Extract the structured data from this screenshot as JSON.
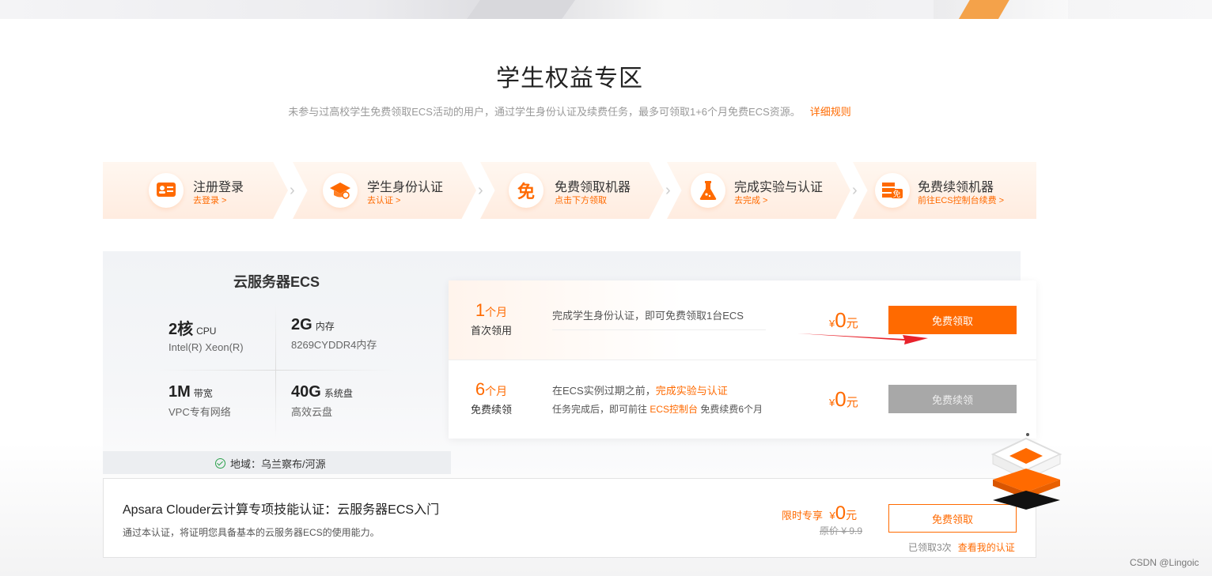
{
  "page": {
    "title": "学生权益专区",
    "subtitle": "未参与过高校学生免费领取ECS活动的用户，通过学生身份认证及续费任务，最多可领取1+6个月免费ECS资源。",
    "rule_link": "详细规则"
  },
  "steps": [
    {
      "label": "注册登录",
      "sub": "去登录 >",
      "icon": "id-card-icon"
    },
    {
      "label": "学生身份认证",
      "sub": "去认证 >",
      "icon": "graduation-cap-icon"
    },
    {
      "label": "免费领取机器",
      "sub": "点击下方领取",
      "icon": "free-badge-icon"
    },
    {
      "label": "完成实验与认证",
      "sub": "去完成 >",
      "icon": "flask-icon"
    },
    {
      "label": "免费续领机器",
      "sub": "前往ECS控制台续费 >",
      "icon": "server-free-icon"
    }
  ],
  "spec": {
    "title": "云服务器ECS",
    "cpu": {
      "value": "2核",
      "unit": "CPU",
      "desc": "Intel(R) Xeon(R)"
    },
    "memory": {
      "value": "2G",
      "unit": "内存",
      "desc": "8269CYDDR4内存"
    },
    "bandwidth": {
      "value": "1M",
      "unit": "带宽",
      "desc": "VPC专有网络"
    },
    "disk": {
      "value": "40G",
      "unit": "系统盘",
      "desc": "高效云盘"
    },
    "region": "地域：乌兰察布/河源"
  },
  "offers": [
    {
      "months": "1",
      "months_unit": "个月",
      "caption": "首次领用",
      "desc": "完成学生身份认证，即可免费领取1台ECS",
      "currency": "¥",
      "price": "0",
      "price_unit": "元",
      "button": "免费领取"
    },
    {
      "months": "6",
      "months_unit": "个月",
      "caption": "免费续领",
      "desc_prefix": "在ECS实例过期之前，",
      "desc_link": "完成实验与认证",
      "desc2_prefix": "任务完成后，即可前往 ",
      "desc2_link": "ECS控制台",
      "desc2_suffix": " 免费续费6个月",
      "currency": "¥",
      "price": "0",
      "price_unit": "元",
      "button": "免费续领"
    }
  ],
  "cert": {
    "title": "Apsara Clouder云计算专项技能认证：云服务器ECS入门",
    "desc": "通过本认证，将证明您具备基本的云服务器ECS的使用能力。",
    "limited_label": "限时专享",
    "currency": "¥",
    "price": "0",
    "price_unit": "元",
    "original": "原价 ¥ 9.9",
    "button": "免费领取",
    "claimed": "已领取3次",
    "view_link": "查看我的认证"
  },
  "watermark": "CSDN @Lingoic",
  "colors": {
    "accent": "#ff6a00",
    "disabled": "#a8a8a8",
    "success": "#2ba24c"
  }
}
